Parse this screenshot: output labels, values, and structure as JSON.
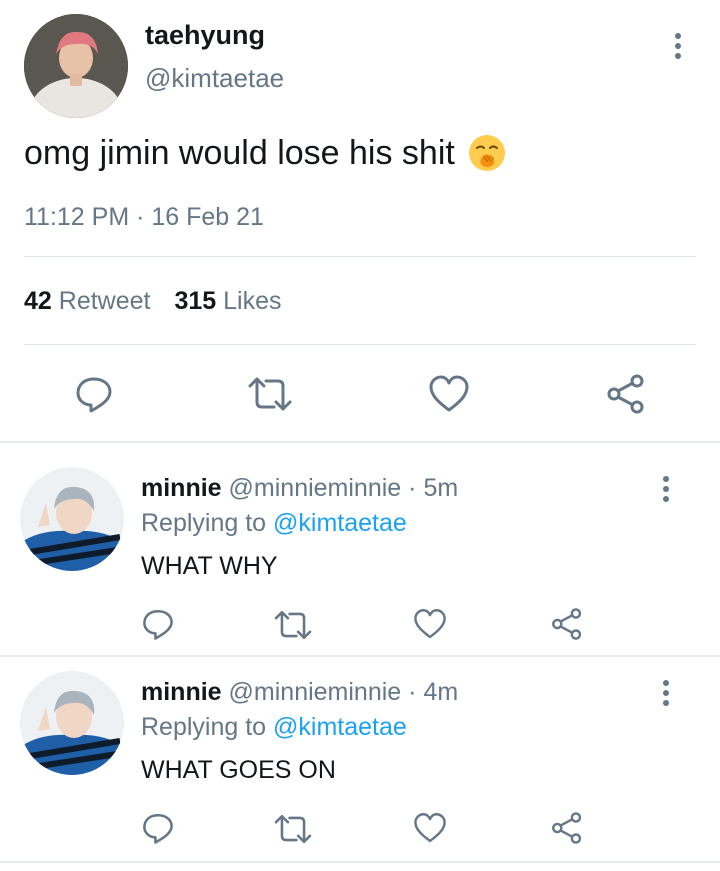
{
  "main_tweet": {
    "display_name": "taehyung",
    "handle": "@kimtaetae",
    "text": "omg jimin would lose his shit",
    "emoji": "yawning-face",
    "timestamp": "11:12 PM · 16 Feb 21",
    "retweet_count": "42",
    "retweet_label": "Retweet",
    "likes_count": "315",
    "likes_label": "Likes"
  },
  "replies": [
    {
      "display_name": "minnie",
      "handle": "@minnieminnie",
      "separator": "·",
      "time": "5m",
      "replying_prefix": "Replying to",
      "replying_to": "@kimtaetae",
      "text": "WHAT WHY"
    },
    {
      "display_name": "minnie",
      "handle": "@minnieminnie",
      "separator": "·",
      "time": "4m",
      "replying_prefix": "Replying to",
      "replying_to": "@kimtaetae",
      "text": "WHAT GOES ON"
    }
  ],
  "colors": {
    "text_primary": "#14171a",
    "text_secondary": "#657786",
    "accent": "#1da1f2",
    "icon": "#657786",
    "divider": "#e1e8ed"
  },
  "icons": [
    "reply-icon",
    "retweet-icon",
    "like-icon",
    "share-icon",
    "more-icon"
  ]
}
